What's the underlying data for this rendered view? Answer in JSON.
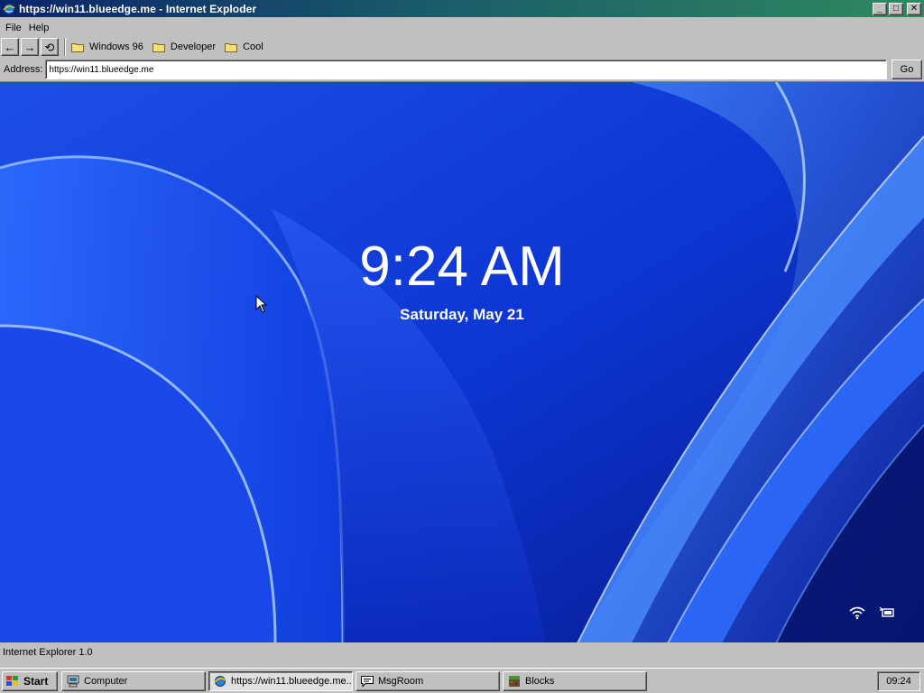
{
  "window": {
    "title": "https://win11.blueedge.me - Internet Exploder",
    "minimize_label": "_",
    "maximize_label": "□",
    "close_label": "✕"
  },
  "menu": [
    "File",
    "Help"
  ],
  "toolbar": {
    "back_label": "←",
    "forward_label": "→",
    "refresh_label": "⟲",
    "bookmarks": [
      "Windows 96",
      "Developer",
      "Cool"
    ]
  },
  "address": {
    "label": "Address:",
    "url": "https://win11.blueedge.me",
    "go_label": "Go"
  },
  "page": {
    "time": "9:24 AM",
    "date": "Saturday, May 21",
    "icons": [
      "wifi-icon",
      "battery-icon"
    ],
    "colors": {
      "wallpaper_dark": "#0a1fa8",
      "wallpaper_light": "#3f82ff"
    }
  },
  "status": {
    "text": "Internet Explorer 1.0"
  },
  "taskbar": {
    "start_label": "Start",
    "tasks": [
      {
        "label": "Computer",
        "icon": "computer-icon",
        "active": false
      },
      {
        "label": "https://win11.blueedge.me...",
        "icon": "browser-globe-icon",
        "active": true
      },
      {
        "label": "MsgRoom",
        "icon": "chat-icon",
        "active": false
      },
      {
        "label": "Blocks",
        "icon": "blocks-icon",
        "active": false
      }
    ],
    "clock": "09:24"
  }
}
